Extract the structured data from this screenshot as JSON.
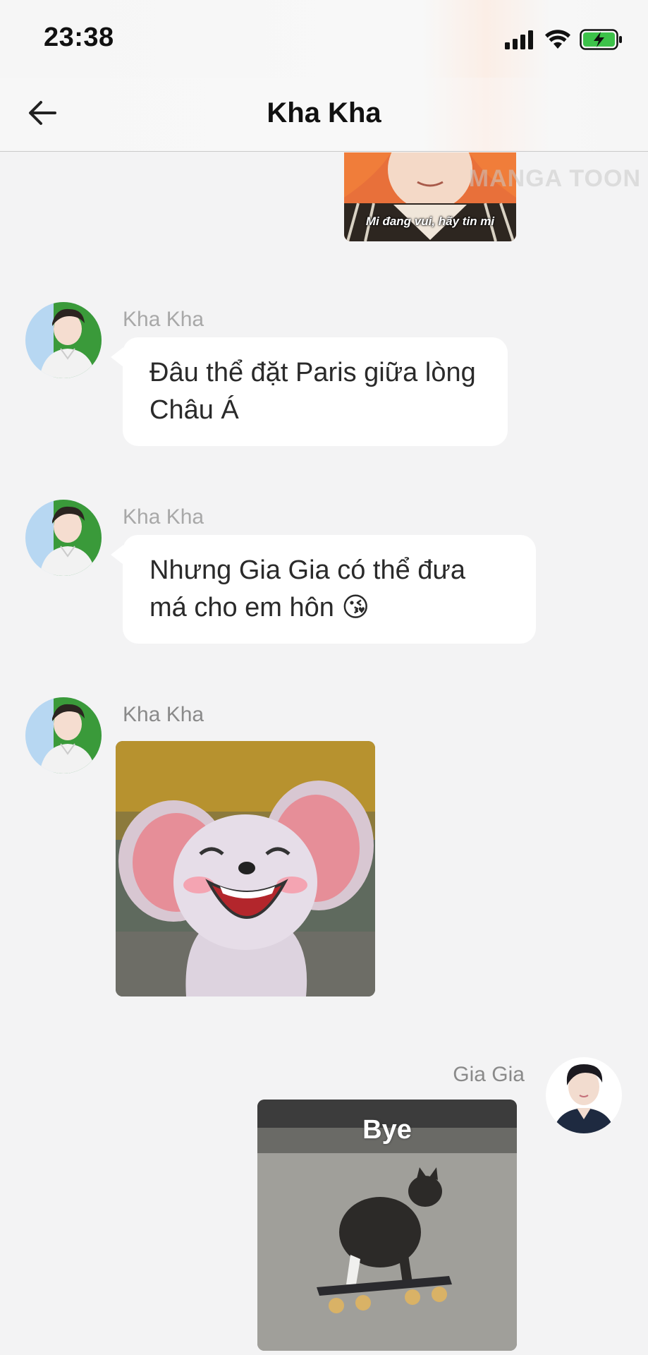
{
  "status_bar": {
    "time": "23:38",
    "icons": [
      "signal-icon",
      "wifi-icon",
      "battery-charging-icon"
    ]
  },
  "header": {
    "title": "Kha Kha",
    "back_icon": "arrow-left-icon"
  },
  "watermark": "MANGA TOON",
  "messages": [
    {
      "type": "image",
      "side": "right",
      "caption": "Mi đang vui, hãy tin mi"
    },
    {
      "type": "text",
      "side": "left",
      "sender": "Kha Kha",
      "text": "Đâu thể đặt Paris giữa lòng Châu Á"
    },
    {
      "type": "text",
      "side": "left",
      "sender": "Kha Kha",
      "text": "Nhưng Gia Gia có thể đưa má cho em hôn 😘"
    },
    {
      "type": "image",
      "side": "left",
      "sender": "Kha Kha",
      "image_subject": "laughing-mouse-sticker"
    },
    {
      "type": "image",
      "side": "right",
      "sender": "Gia Gia",
      "caption": "Bye",
      "image_subject": "cat-on-skateboard-sticker"
    }
  ],
  "colors": {
    "background": "#f3f3f4",
    "bubble": "#ffffff",
    "battery": "#3dc24a"
  }
}
